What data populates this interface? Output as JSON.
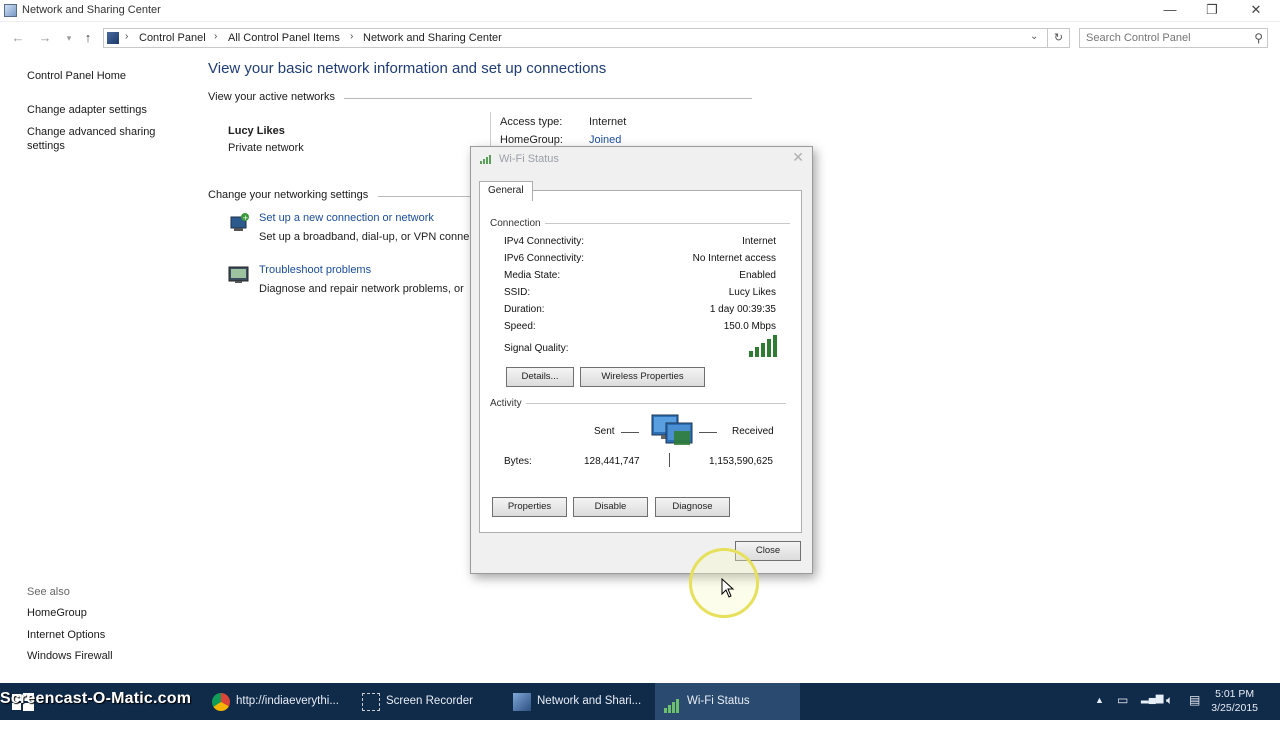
{
  "window": {
    "title": "Network and Sharing Center",
    "minimize": "—",
    "restore": "❐",
    "close": "✕"
  },
  "nav": {
    "back": "←",
    "forward": "→",
    "up": "↑",
    "refresh": "↻"
  },
  "breadcrumb": [
    "Control Panel",
    "All Control Panel Items",
    "Network and Sharing Center"
  ],
  "search": {
    "placeholder": "Search Control Panel"
  },
  "sidebar": {
    "home": "Control Panel Home",
    "items": [
      "Change adapter settings",
      "Change advanced sharing settings"
    ],
    "see_also_title": "See also",
    "see_also": [
      "HomeGroup",
      "Internet Options",
      "Windows Firewall"
    ]
  },
  "main": {
    "title": "View your basic network information and set up connections",
    "active_networks_header": "View your active networks",
    "network_name": "Lucy Likes",
    "network_type": "Private network",
    "access_type_label": "Access type:",
    "access_type_value": "Internet",
    "homegroup_label": "HomeGroup:",
    "homegroup_value": "Joined",
    "change_settings_header": "Change your networking settings",
    "tasks": [
      {
        "link": "Set up a new connection or network",
        "desc": "Set up a broadband, dial-up, or VPN conne"
      },
      {
        "link": "Troubleshoot problems",
        "desc": "Diagnose and repair network problems, or"
      }
    ]
  },
  "dialog": {
    "title": "Wi-Fi Status",
    "tab": "General",
    "connection_group": "Connection",
    "properties": [
      {
        "label": "IPv4 Connectivity:",
        "value": "Internet"
      },
      {
        "label": "IPv6 Connectivity:",
        "value": "No Internet access"
      },
      {
        "label": "Media State:",
        "value": "Enabled"
      },
      {
        "label": "SSID:",
        "value": "Lucy Likes"
      },
      {
        "label": "Duration:",
        "value": "1 day 00:39:35"
      },
      {
        "label": "Speed:",
        "value": "150.0 Mbps"
      }
    ],
    "signal_label": "Signal Quality:",
    "signal_bars": 5,
    "details_button": "Details...",
    "wireless_button": "Wireless Properties",
    "activity_group": "Activity",
    "sent_label": "Sent",
    "received_label": "Received",
    "bytes_label": "Bytes:",
    "bytes_sent": "128,441,747",
    "bytes_received": "1,153,590,625",
    "properties_button": "Properties",
    "disable_button": "Disable",
    "diagnose_button": "Diagnose",
    "close_button": "Close"
  },
  "taskbar": {
    "watermark": "Screencast-O-Matic.com",
    "tasks": [
      "http://indiaeverythi...",
      "Screen Recorder",
      "Network and Shari...",
      "Wi-Fi Status"
    ],
    "time": "5:01 PM",
    "date": "3/25/2015",
    "tray_chevron": "▲"
  },
  "colors": {
    "link": "#1a4d9e",
    "title": "#1e3c78",
    "taskbar": "#102a4a",
    "signal": "#2e7d32"
  }
}
